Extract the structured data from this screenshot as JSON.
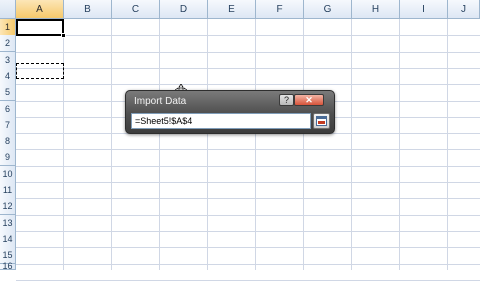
{
  "sheet": {
    "columns": [
      "A",
      "B",
      "C",
      "D",
      "E",
      "F",
      "G",
      "H",
      "I",
      "J"
    ],
    "rows": [
      "1",
      "2",
      "3",
      "4",
      "5",
      "6",
      "7",
      "8",
      "9",
      "10",
      "11",
      "12",
      "13",
      "14",
      "15",
      "16"
    ],
    "active_column": "A",
    "active_row": "1",
    "copied_cell": "A4"
  },
  "dialog": {
    "title": "Import Data",
    "help_label": "?",
    "close_label": "✕",
    "reference_value": "=Sheet5!$A$4"
  },
  "icons": {
    "collapse": "expand-dialog-icon",
    "cursor": "move-cursor-icon"
  },
  "colors": {
    "header_active": "#f6c96b",
    "gridline": "#d0d7e5",
    "dialog_frame": "#4e4e4e",
    "close_button": "#d7533a"
  }
}
